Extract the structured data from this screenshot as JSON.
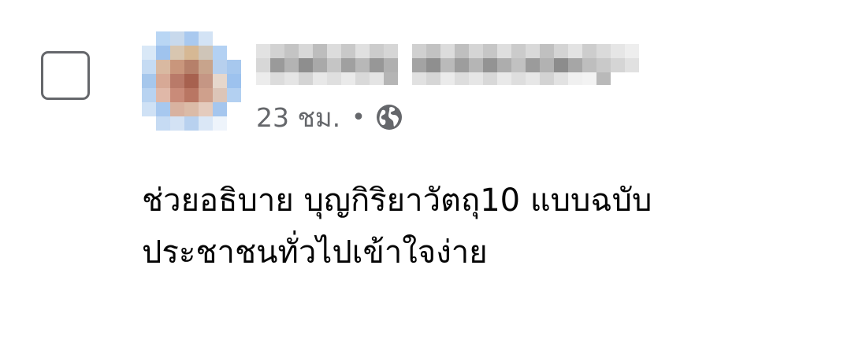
{
  "comment": {
    "author_name": "",
    "timestamp": "23 ชม.",
    "separator": "•",
    "privacy_icon": "globe-icon",
    "lines": [
      "ช่วยอธิบาย บุญกิริยาวัตถุ10 แบบฉบับ",
      "ประชาชนทั่วไปเข้าใจง่าย"
    ]
  },
  "select_checkbox": {
    "checked": false
  },
  "colors": {
    "text_primary": "#050505",
    "text_secondary": "#65676b",
    "checkbox_border": "#65676b",
    "background": "#ffffff"
  }
}
